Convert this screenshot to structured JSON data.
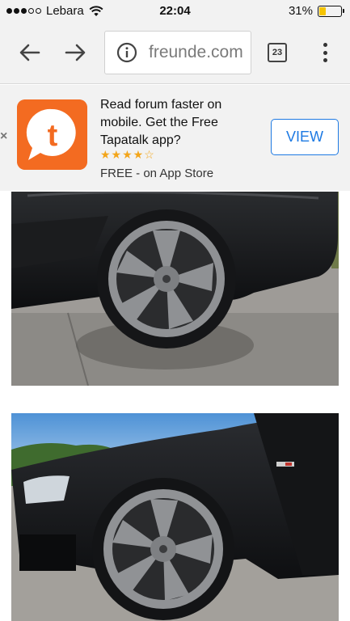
{
  "status_bar": {
    "carrier": "Lebara",
    "time": "22:04",
    "battery_percent": "31%",
    "battery_level": 0.31,
    "battery_color": "#f5c400"
  },
  "toolbar": {
    "back_icon": "arrow-left-icon",
    "forward_icon": "arrow-right-icon",
    "url": "freunde.com",
    "tab_count": "23",
    "menu_icon": "kebab-menu-icon"
  },
  "banner": {
    "close_label": "×",
    "title": "Read forum faster on mobile. Get the Free Tapatalk app?",
    "rating_stars": "★★★★☆",
    "rating_value": 4.5,
    "subtitle": "FREE - on App Store",
    "button_label": "VIEW",
    "app_icon_letter": "t",
    "app_icon_color": "#f36b21",
    "button_color": "#1e7ae3"
  },
  "content": {
    "photos": [
      {
        "subject": "rear wheel of black car"
      },
      {
        "subject": "front wheel of black car"
      }
    ]
  }
}
